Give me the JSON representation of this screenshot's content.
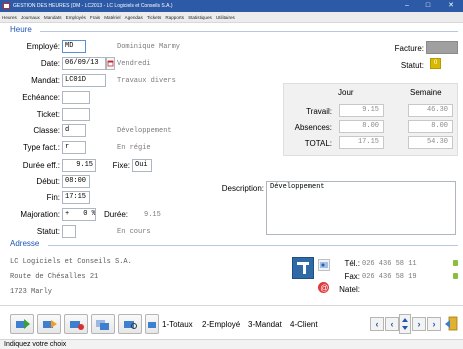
{
  "window": {
    "title": "GESTION DES HEURES (DM - LC2013 - LC Logiciels et Conseils S.A.)",
    "controls": [
      "–",
      "□",
      "✕"
    ]
  },
  "menu": [
    "Heures",
    "Journaux",
    "Mandats",
    "Employés",
    "Frais",
    "Matériel",
    "Agendas",
    "Tickets",
    "Rapports",
    "Statistiques",
    "Utilitaires"
  ],
  "heure": {
    "section_title": "Heure",
    "employe": {
      "label": "Employé:",
      "code": "MD",
      "name": "Dominique Marmy"
    },
    "date": {
      "label": "Date:",
      "value": "06/09/13",
      "weekday": "Vendredi"
    },
    "mandat": {
      "label": "Mandat:",
      "code": "LC01D",
      "name": "Travaux divers"
    },
    "echeance": {
      "label": "Echéance:",
      "value": ""
    },
    "ticket": {
      "label": "Ticket:",
      "value": ""
    },
    "classe": {
      "label": "Classe:",
      "code": "d",
      "name": "Développement"
    },
    "type_fact": {
      "label": "Type fact.:",
      "code": "r",
      "name": "En régie"
    },
    "duree_eff": {
      "label": "Durée eff.:",
      "value": "9.15"
    },
    "fixe": {
      "label": "Fixe:",
      "value": "Oui"
    },
    "debut": {
      "label": "Début:",
      "value": "08:00"
    },
    "fin": {
      "label": "Fin:",
      "value": "17:15"
    },
    "majoration": {
      "label": "Majoration:",
      "sign": "+",
      "value": "0",
      "unit": "%"
    },
    "duree": {
      "label": "Durée:",
      "value": "9.15"
    },
    "statut": {
      "label": "Statut:",
      "value": "",
      "text": "En cours"
    },
    "facture": {
      "label": "Facture:"
    },
    "statut_right": {
      "label": "Statut:",
      "value": "0"
    },
    "description": {
      "label": "Description:",
      "value": "Développement"
    }
  },
  "stats": {
    "col_jour": "Jour",
    "col_semaine": "Semaine",
    "rows": [
      {
        "label": "Travail:",
        "jour": "9.15",
        "semaine": "46.30"
      },
      {
        "label": "Absences:",
        "jour": "8.00",
        "semaine": "8.00"
      },
      {
        "label": "TOTAL:",
        "jour": "17.15",
        "semaine": "54.30"
      }
    ]
  },
  "adresse": {
    "section_title": "Adresse",
    "lines": [
      "LC Logiciels et Conseils S.A.",
      "Route de Chésalles 21",
      "1723 Marly"
    ],
    "tel_label": "Tél.:",
    "tel": "026 436 58 11",
    "fax_label": "Fax:",
    "fax": "026 436 58 19",
    "natel_label": "Natel:",
    "natel": ""
  },
  "toolbar": {
    "buttons": [
      "1-Totaux",
      "2-Employé",
      "3-Mandat",
      "4-Client"
    ]
  },
  "colors": {
    "accent": "#1f56b3",
    "titlebar": "#2d5aa6",
    "statut_badge": "#d8b800"
  },
  "status_bar": "Indiquez votre choix"
}
